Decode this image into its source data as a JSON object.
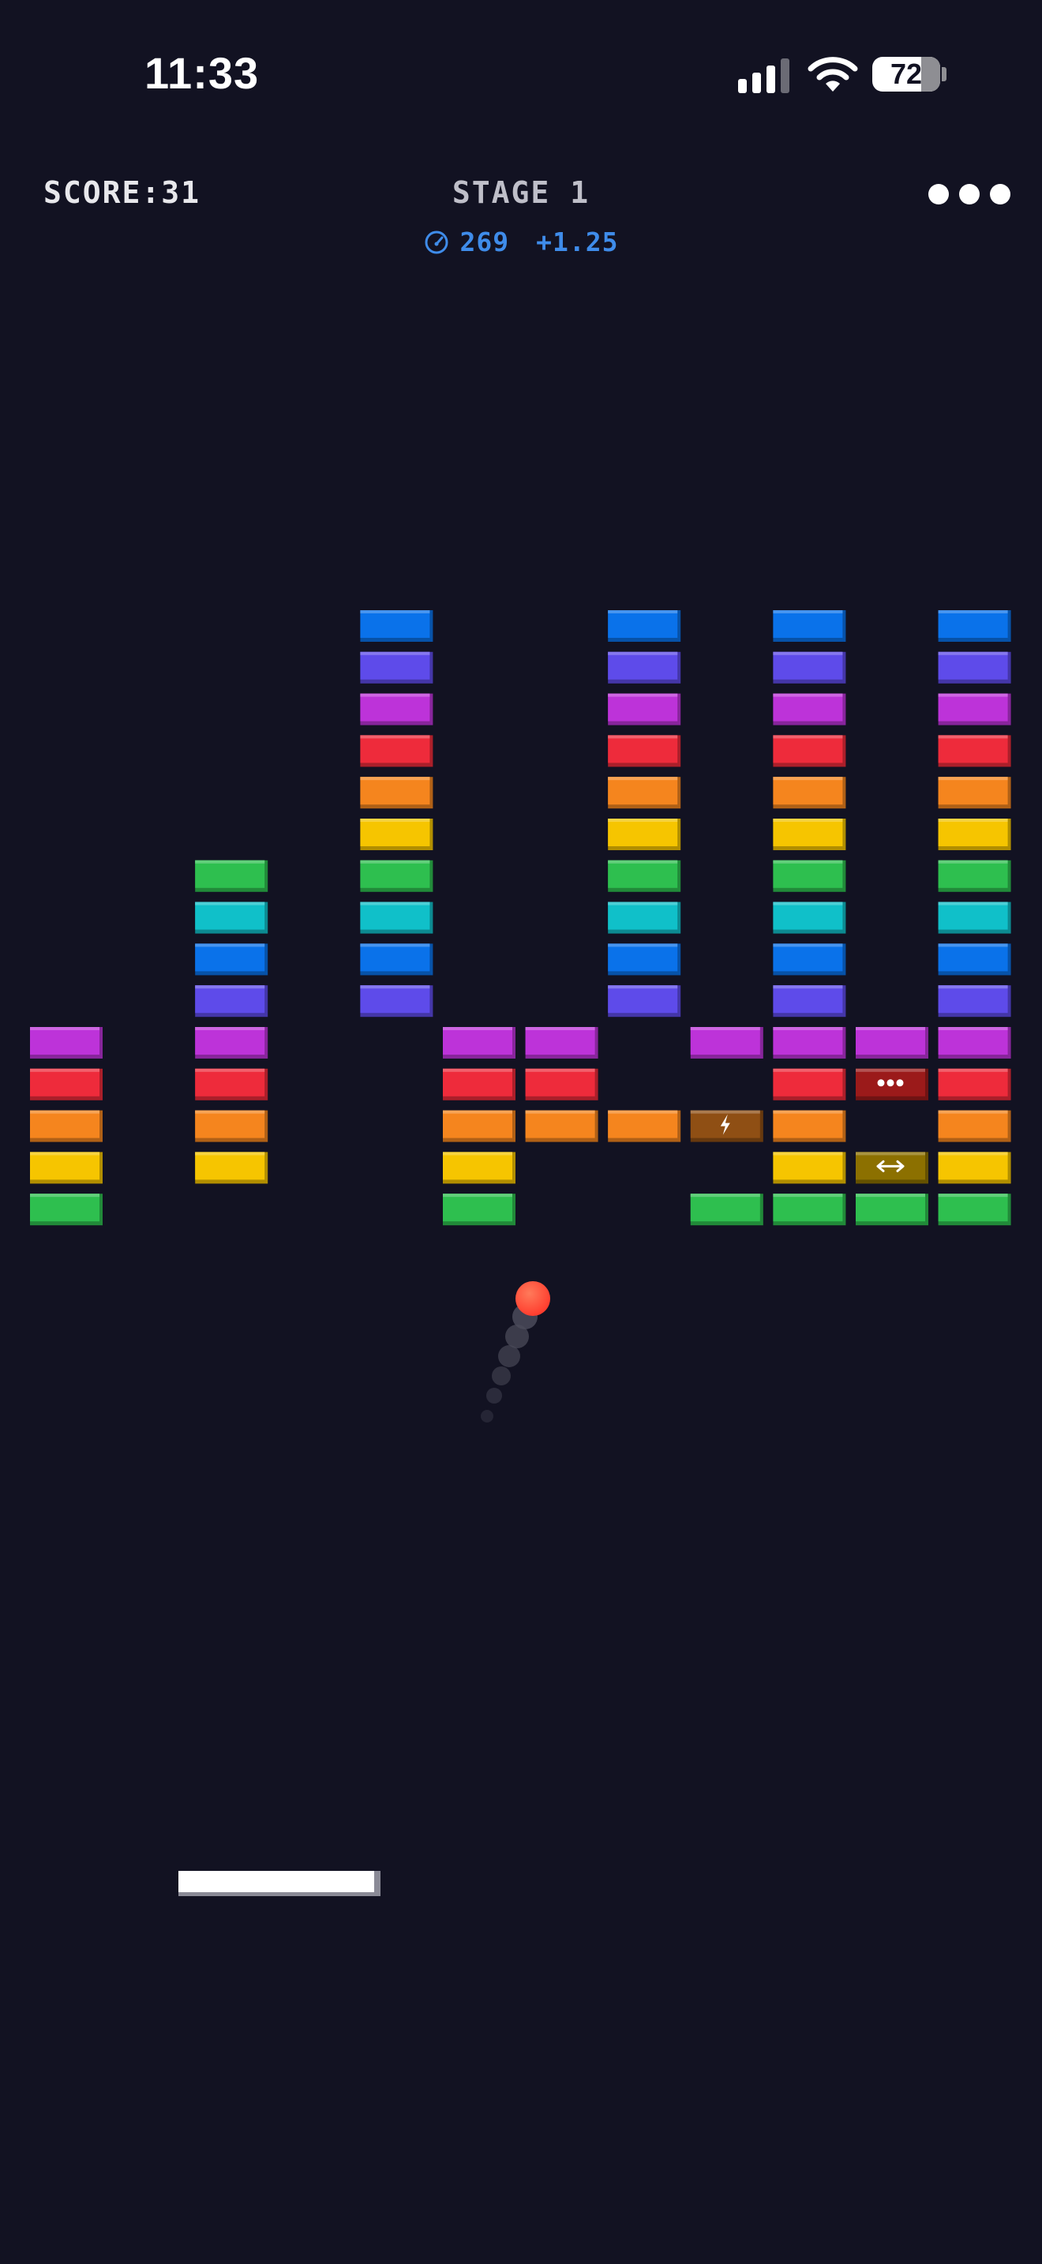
{
  "status_bar": {
    "time": "11:33",
    "battery": "72",
    "icons": [
      "signal-icon",
      "wifi-icon",
      "battery-icon"
    ]
  },
  "hud": {
    "score_label": "SCORE:",
    "score_value": "31",
    "stage_label": "STAGE",
    "stage_value": "1",
    "speed_icon": "speedometer-icon",
    "speed_value": "269",
    "speed_bonus": "+1.25",
    "menu_icon": "more-dots-icon"
  },
  "colors": {
    "background": "#121222",
    "brick_colors": {
      "B": "#0a72ea",
      "V": "#5e4bea",
      "M": "#bd33d9",
      "R": "#ee2b3b",
      "O": "#f5851e",
      "Y": "#f6c500",
      "G": "#2ebf4f",
      "C": "#10c0c9",
      "p1": "#9b1a1a",
      "p2": "#8f4f14",
      "p3": "#8c7000"
    },
    "ball": "#ff3d2e",
    "trail": "#4b4b5a",
    "hud_blue": "#3f8cea"
  },
  "board": {
    "legend": "Each row string lists 12 columns; '.' = empty, letter = brick colour key, digit = power-up brick",
    "rows": [
      "....B..B.B.B",
      "....V..V.V.V",
      "....M..M.M.M",
      "....R..R.R.R",
      "....O..O.O.O",
      "....Y..Y.Y.Y",
      "..G.G..G.G.G",
      "..C.C..C.C.C",
      "..B.B..B.B.B",
      "..V.V..V.V.V",
      "M.M..MM.MMMM",
      "R.R..RR..R1R",
      "O.O..OOO2O.O",
      "Y.Y..Y...Y3Y",
      "G....G..GGGG"
    ],
    "powerups": {
      "1": {
        "icon": "multiball-icon"
      },
      "2": {
        "icon": "lightning-icon"
      },
      "3": {
        "icon": "expand-arrows-icon"
      }
    }
  }
}
